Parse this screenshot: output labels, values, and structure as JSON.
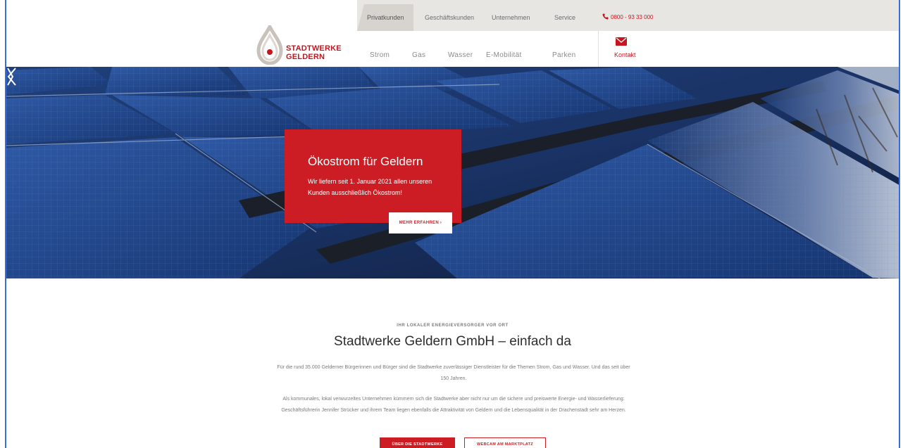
{
  "meta_nav": {
    "items": [
      {
        "label": "Privatkunden",
        "active": true
      },
      {
        "label": "Geschäftskunden"
      },
      {
        "label": "Unternehmen"
      },
      {
        "label": "Service"
      }
    ],
    "phone": "0800 - 93 33 000"
  },
  "logo": {
    "line1": "STADTWERKE",
    "line2": "GELDERN"
  },
  "main_nav": {
    "items": [
      "Strom",
      "Gas",
      "Wasser",
      "E-Mobilität",
      "Parken"
    ],
    "contact_label": "Kontakt"
  },
  "hero": {
    "title": "Ökostrom für Geldern",
    "text": "Wir liefern seit 1. Januar 2021 allen unseren Kunden ausschließlich Ökostrom!",
    "button": "MEHR ERFAHREN ›"
  },
  "intro": {
    "eyebrow": "IHR LOKALER ENERGIEVERSORGER VOR ORT",
    "headline": "Stadtwerke Geldern GmbH – einfach da",
    "paragraph1": "Für die rund 35.000 Gelderner Bürgerinnen und Bürger sind die Stadtwerke zuverlässiger Dienstleister für die Themen Strom, Gas und Wasser. Und das seit über 150 Jahren.",
    "paragraph2": "Als kommunales, lokal verwurzeltes Unternehmen kümmern sich die Stadtwerke aber nicht nur um die sichere und preiswerte Energie- und Wasserlieferung: Geschäftsführerin Jennifer Strücker und ihrem Team liegen ebenfalls die Attraktivität von Geldern und die Lebensqualität in der Drachenstadt sehr am Herzen.",
    "button_primary": "ÜBER DIE STADTWERKE",
    "button_secondary": "WEBCAM AM MARKTPLATZ"
  },
  "colors": {
    "brand_red": "#cc1d24",
    "meta_bg": "#e8e6e3",
    "text_gray": "#7a7a7a"
  }
}
